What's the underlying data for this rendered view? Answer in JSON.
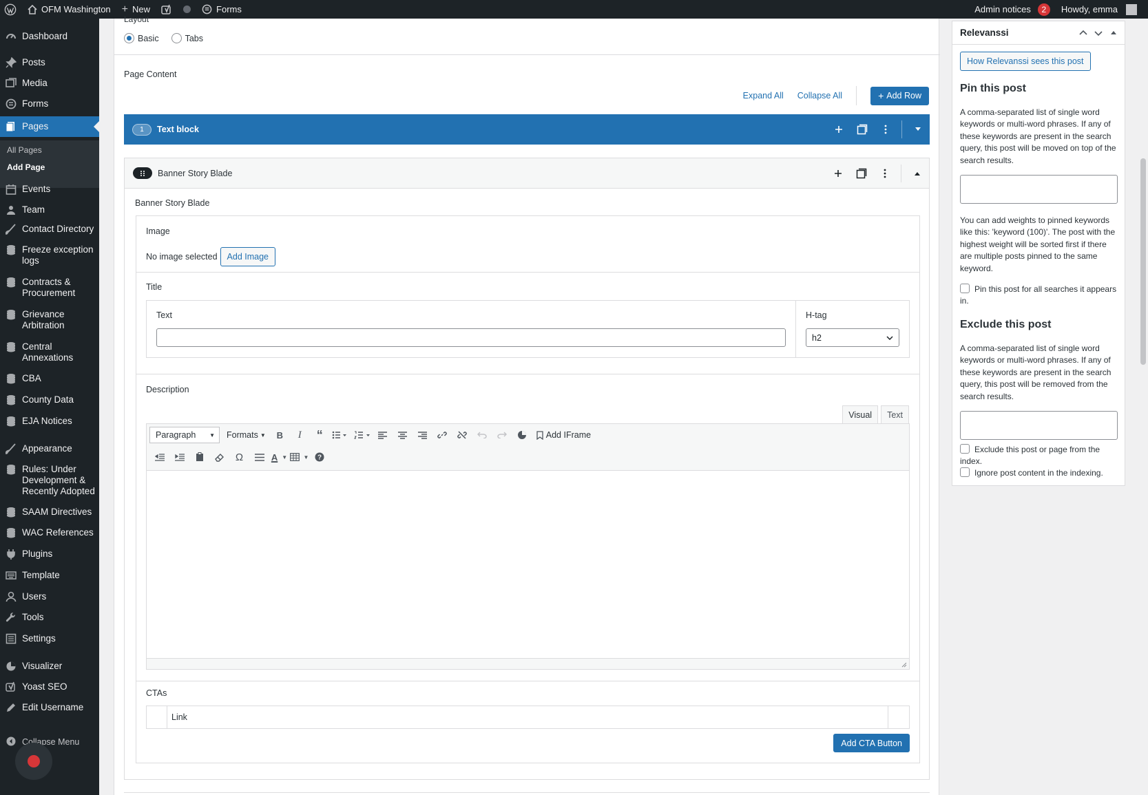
{
  "admin_bar": {
    "site_name": "OFM Washington",
    "new_label": "New",
    "forms_label": "Forms",
    "admin_notices_label": "Admin notices",
    "admin_notices_count": "2",
    "howdy": "Howdy, emma"
  },
  "sidebar": {
    "items": [
      {
        "label": "Dashboard",
        "icon": "gauge-icon"
      },
      {
        "label": "Posts",
        "icon": "pin-icon"
      },
      {
        "label": "Media",
        "icon": "media-icon"
      },
      {
        "label": "Forms",
        "icon": "forms-icon"
      },
      {
        "label": "Pages",
        "icon": "pages-icon"
      },
      {
        "label": "Events",
        "icon": "calendar-icon"
      },
      {
        "label": "Team",
        "icon": "users-icon"
      },
      {
        "label": "Contact Directory",
        "icon": "brush-icon"
      },
      {
        "label": "Freeze exception logs",
        "icon": "database-icon"
      },
      {
        "label": "Contracts & Procurement",
        "icon": "database-icon"
      },
      {
        "label": "Grievance Arbitration",
        "icon": "database-icon"
      },
      {
        "label": "Central Annexations",
        "icon": "database-icon"
      },
      {
        "label": "CBA",
        "icon": "database-icon"
      },
      {
        "label": "County Data",
        "icon": "database-icon"
      },
      {
        "label": "EJA Notices",
        "icon": "database-icon"
      },
      {
        "label": "Appearance",
        "icon": "brush-icon"
      },
      {
        "label": "Rules: Under Development & Recently Adopted",
        "icon": "database-icon"
      },
      {
        "label": "SAAM Directives",
        "icon": "database-icon"
      },
      {
        "label": "WAC References",
        "icon": "database-icon"
      },
      {
        "label": "Plugins",
        "icon": "plug-icon"
      },
      {
        "label": "Template",
        "icon": "keyboard-icon"
      },
      {
        "label": "Users",
        "icon": "user-icon"
      },
      {
        "label": "Tools",
        "icon": "wrench-icon"
      },
      {
        "label": "Settings",
        "icon": "settings-icon"
      },
      {
        "label": "Visualizer",
        "icon": "chart-icon"
      },
      {
        "label": "Yoast SEO",
        "icon": "yoast-icon"
      },
      {
        "label": "Edit Username",
        "icon": "pencil-icon"
      }
    ],
    "submenu": {
      "all_pages": "All Pages",
      "add_page": "Add Page"
    },
    "collapse_label": "Collapse Menu"
  },
  "main": {
    "layout_label": "Layout",
    "layout_options": {
      "basic": "Basic",
      "tabs": "Tabs",
      "selected": "Basic"
    },
    "page_content_label": "Page Content",
    "expand_all": "Expand All",
    "collapse_all": "Collapse All",
    "add_row": "Add Row",
    "rows": [
      {
        "number": "1",
        "title": "Text block"
      },
      {
        "title": "Banner Story Blade"
      }
    ],
    "blade": {
      "label": "Banner Story Blade",
      "image_label": "Image",
      "no_image": "No image selected",
      "add_image": "Add Image",
      "title_label": "Title",
      "text_label": "Text",
      "text_value": "",
      "htag_label": "H-tag",
      "htag_value": "h2",
      "description_label": "Description",
      "editor_tabs": {
        "visual": "Visual",
        "text": "Text"
      },
      "paragraph_select": "Paragraph",
      "formats": "Formats",
      "add_iframe": "Add IFrame",
      "ctas_label": "CTAs",
      "cta_column": "Link",
      "add_cta": "Add CTA Button"
    }
  },
  "relevanssi": {
    "title": "Relevanssi",
    "how_button": "How Relevanssi sees this post",
    "pin_heading": "Pin this post",
    "pin_desc": "A comma-separated list of single word keywords or multi-word phrases. If any of these keywords are present in the search query, this post will be moved on top of the search results.",
    "weights_desc": "You can add weights to pinned keywords like this: 'keyword (100)'. The post with the highest weight will be sorted first if there are multiple posts pinned to the same keyword.",
    "pin_all": "Pin this post for all searches it appears in.",
    "exclude_heading": "Exclude this post",
    "exclude_desc": "A comma-separated list of single word keywords or multi-word phrases. If any of these keywords are present in the search query, this post will be removed from the search results.",
    "exclude_index": "Exclude this post or page from the index.",
    "ignore_content": "Ignore post content in the indexing."
  },
  "colors": {
    "accent": "#2271b1",
    "adminbar": "#1d2327",
    "badge": "#d63638"
  }
}
